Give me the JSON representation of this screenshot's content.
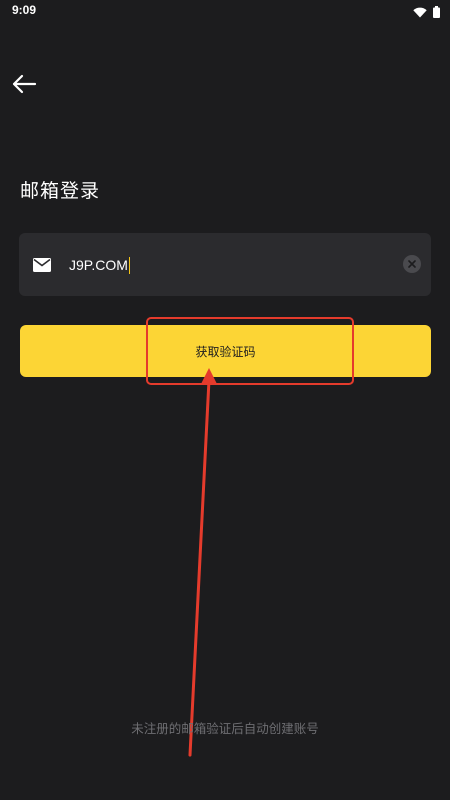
{
  "status_bar": {
    "time": "9:09",
    "icons": [
      "wifi-icon",
      "battery-icon"
    ]
  },
  "header": {
    "back_icon": "arrow-left-icon",
    "title": "邮箱登录"
  },
  "email_field": {
    "icon": "mail-icon",
    "value": "J9P.COM",
    "clear_icon": "clear-icon"
  },
  "primary_button": {
    "label": "获取验证码"
  },
  "footer": {
    "note": "未注册的邮箱验证后自动创建账号"
  },
  "colors": {
    "background": "#1c1c1e",
    "input_background": "#2b2b2e",
    "accent_yellow": "#fcd535",
    "caret": "#f5c518",
    "annotation_red": "#e53b2c",
    "muted_text": "#6e6e72"
  }
}
